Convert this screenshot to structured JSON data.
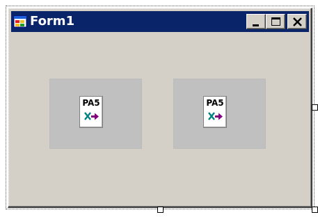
{
  "window": {
    "title": "Form1",
    "icon": "form-app-icon",
    "titlebar_color": "#0a246a",
    "client_color": "#d4d0c8"
  },
  "titlebar_buttons": [
    {
      "name": "minimize",
      "icon": "minimize-icon"
    },
    {
      "name": "maximize",
      "icon": "maximize-icon"
    },
    {
      "name": "close",
      "icon": "close-icon"
    }
  ],
  "controls": [
    {
      "label": "PA5",
      "icon": "pa5-transform-icon"
    },
    {
      "label": "PA5",
      "icon": "pa5-transform-icon"
    }
  ],
  "colors": {
    "glyph_teal": "#008080",
    "glyph_purple": "#800080",
    "tray_gray": "#c0c0c0"
  }
}
